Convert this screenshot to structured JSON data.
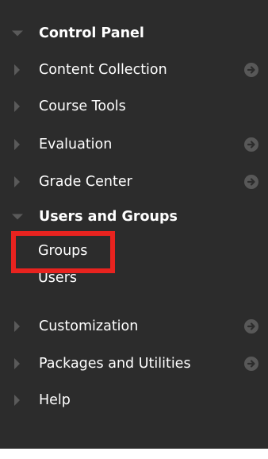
{
  "control_panel": {
    "title": "Control Panel",
    "items": [
      {
        "label": "Content Collection",
        "has_arrow": true
      },
      {
        "label": "Course Tools",
        "has_arrow": false
      },
      {
        "label": "Evaluation",
        "has_arrow": true
      },
      {
        "label": "Grade Center",
        "has_arrow": true
      }
    ],
    "users_and_groups": {
      "title": "Users and Groups",
      "children": [
        "Groups",
        "Users"
      ]
    },
    "items_after": [
      {
        "label": "Customization",
        "has_arrow": true
      },
      {
        "label": "Packages and Utilities",
        "has_arrow": true
      },
      {
        "label": "Help",
        "has_arrow": false
      }
    ],
    "colors": {
      "panel_bg": "#2c2c2c",
      "text": "#ffffff",
      "icon": "#5a5a5a",
      "highlight_border": "#e8231f"
    },
    "icons": {
      "expanded": "triangle-down-icon",
      "collapsed": "triangle-right-icon",
      "go": "arrow-circle-right-icon"
    }
  }
}
